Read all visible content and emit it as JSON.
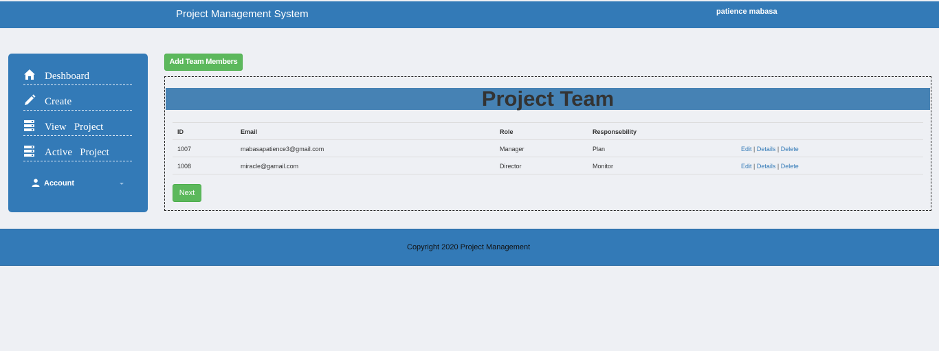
{
  "header": {
    "app_title": "Project Management System",
    "user_name": "patience mabasa"
  },
  "sidebar": {
    "items": [
      {
        "label": "Deshboard",
        "icon": "home-icon"
      },
      {
        "label": "Create",
        "icon": "pencil-icon"
      },
      {
        "label": "View   Project",
        "icon": "server-icon"
      },
      {
        "label": "Active   Project",
        "icon": "server-icon"
      }
    ],
    "account_label": "Account",
    "account_icon": "user-icon"
  },
  "actions": {
    "add_team_members_label": "Add Team Members",
    "next_label": "Next"
  },
  "panel": {
    "title": "Project Team"
  },
  "table": {
    "columns": [
      "ID",
      "Email",
      "Role",
      "Responsebility"
    ],
    "rows": [
      {
        "id": "1007",
        "email": "mabasapatience3@gmail.com",
        "role": "Manager",
        "responsibility": "Plan",
        "edit": "Edit",
        "details": "Details",
        "delete": "Delete"
      },
      {
        "id": "1008",
        "email": "miracle@gamail.com",
        "role": "Director",
        "responsibility": "Monitor",
        "edit": "Edit",
        "details": "Details",
        "delete": "Delete"
      }
    ],
    "separator": " | "
  },
  "footer": {
    "copyright": "Copyright 2020 Project Management"
  },
  "colors": {
    "primary": "#337ab7",
    "panel_header": "#4682b4",
    "success": "#5cb85c",
    "page_bg": "#eef0f4"
  }
}
